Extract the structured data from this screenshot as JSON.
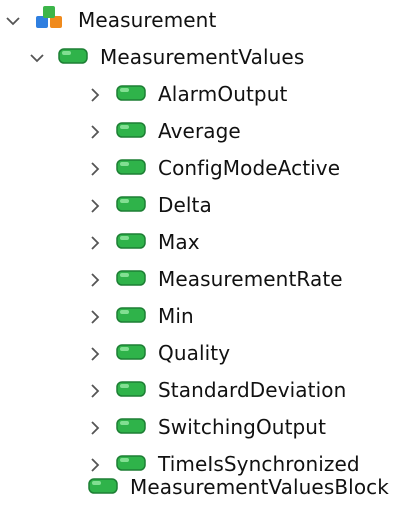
{
  "tree": {
    "root": {
      "label": "Measurement",
      "icon": "object-cubes-icon",
      "expanded": true
    },
    "folder": {
      "label": "MeasurementValues",
      "icon": "variable-tag-icon",
      "expanded": true
    },
    "children": [
      {
        "label": "AlarmOutput",
        "icon": "variable-tag-icon",
        "expanded": false
      },
      {
        "label": "Average",
        "icon": "variable-tag-icon",
        "expanded": false
      },
      {
        "label": "ConfigModeActive",
        "icon": "variable-tag-icon",
        "expanded": false
      },
      {
        "label": "Delta",
        "icon": "variable-tag-icon",
        "expanded": false
      },
      {
        "label": "Max",
        "icon": "variable-tag-icon",
        "expanded": false
      },
      {
        "label": "MeasurementRate",
        "icon": "variable-tag-icon",
        "expanded": false
      },
      {
        "label": "Min",
        "icon": "variable-tag-icon",
        "expanded": false
      },
      {
        "label": "Quality",
        "icon": "variable-tag-icon",
        "expanded": false
      },
      {
        "label": "StandardDeviation",
        "icon": "variable-tag-icon",
        "expanded": false
      },
      {
        "label": "SwitchingOutput",
        "icon": "variable-tag-icon",
        "expanded": false
      },
      {
        "label": "TimeIsSynchronized",
        "icon": "variable-tag-icon",
        "expanded": false
      }
    ],
    "sibling": {
      "label": "MeasurementValuesBlock",
      "icon": "variable-tag-icon",
      "expanded": false
    }
  },
  "colors": {
    "tag_green": "#2fb34a",
    "tag_green_dark": "#1d7f34",
    "cube_blue": "#2f7fe0",
    "cube_orange": "#f08a1c",
    "cube_green": "#3cb54a",
    "chevron": "#555555",
    "text": "#111111"
  }
}
